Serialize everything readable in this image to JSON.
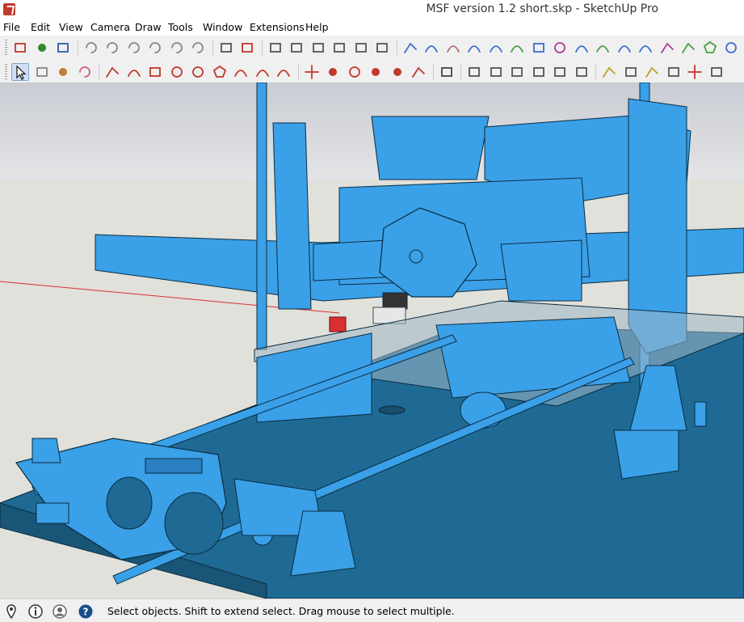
{
  "window": {
    "title": "MSF version 1.2 short.skp - SketchUp Pro"
  },
  "menu": [
    "File",
    "Edit",
    "View",
    "Camera",
    "Draw",
    "Tools",
    "Window",
    "Extensions",
    "Help"
  ],
  "toolbar1": [
    {
      "name": "new-model-icon",
      "color": "#c0392b"
    },
    {
      "name": "open-icon",
      "color": "#2e8b2e"
    },
    {
      "name": "save-icon",
      "color": "#2a5caa"
    },
    {
      "name": "cut-icon",
      "color": "#888888"
    },
    {
      "name": "copy-icon",
      "color": "#888888"
    },
    {
      "name": "paste-icon",
      "color": "#888888"
    },
    {
      "name": "erase-icon",
      "color": "#888888"
    },
    {
      "name": "undo-icon",
      "color": "#888888"
    },
    {
      "name": "redo-icon",
      "color": "#888888"
    },
    {
      "name": "print-icon",
      "color": "#555555"
    },
    {
      "name": "model-info-icon",
      "color": "#c0392b"
    },
    {
      "name": "iso-view-icon",
      "color": "#555555"
    },
    {
      "name": "top-view-icon",
      "color": "#555555"
    },
    {
      "name": "front-view-icon",
      "color": "#555555"
    },
    {
      "name": "right-view-icon",
      "color": "#555555"
    },
    {
      "name": "back-view-icon",
      "color": "#555555"
    },
    {
      "name": "left-view-icon",
      "color": "#555555"
    },
    {
      "name": "line-tool-icon",
      "color": "#3a6fd0"
    },
    {
      "name": "arc-tool-icon",
      "color": "#3a6fd0"
    },
    {
      "name": "freehand-icon",
      "color": "#b07070"
    },
    {
      "name": "curve-icon",
      "color": "#3a6fd0"
    },
    {
      "name": "offset-curve-icon",
      "color": "#3a6fd0"
    },
    {
      "name": "arc-green-icon",
      "color": "#49a040"
    },
    {
      "name": "rectangle-icon",
      "color": "#3a6fd0"
    },
    {
      "name": "circle-icon",
      "color": "#b03a9a"
    },
    {
      "name": "arc-blue-icon",
      "color": "#3a6fd0"
    },
    {
      "name": "bezier-icon",
      "color": "#49a040"
    },
    {
      "name": "fillet-icon",
      "color": "#3a6fd0"
    },
    {
      "name": "corner-icon",
      "color": "#3a6fd0"
    },
    {
      "name": "polyline-icon",
      "color": "#b03a9a"
    },
    {
      "name": "extend-icon",
      "color": "#49a040"
    },
    {
      "name": "polygon-icon",
      "color": "#49a040"
    },
    {
      "name": "spiral-icon",
      "color": "#3a6fd0"
    }
  ],
  "toolbar2": [
    {
      "name": "select-tool-icon",
      "color": "#222222",
      "selected": true
    },
    {
      "name": "component-icon",
      "color": "#888888"
    },
    {
      "name": "paint-bucket-icon",
      "color": "#c08030"
    },
    {
      "name": "eraser-icon",
      "color": "#d06080"
    },
    {
      "name": "pencil-icon",
      "color": "#c0392b"
    },
    {
      "name": "freehand-draw-icon",
      "color": "#c0392b"
    },
    {
      "name": "rectangle-draw-icon",
      "color": "#c0392b"
    },
    {
      "name": "rotated-rect-icon",
      "color": "#c0392b"
    },
    {
      "name": "circle-draw-icon",
      "color": "#c0392b"
    },
    {
      "name": "polygon-draw-icon",
      "color": "#c0392b"
    },
    {
      "name": "arc-draw-icon",
      "color": "#c0392b"
    },
    {
      "name": "arc-2pt-icon",
      "color": "#c0392b"
    },
    {
      "name": "pie-icon",
      "color": "#c0392b"
    },
    {
      "name": "move-icon",
      "color": "#c0392b"
    },
    {
      "name": "push-pull-icon",
      "color": "#c0392b"
    },
    {
      "name": "rotate-icon",
      "color": "#c0392b"
    },
    {
      "name": "follow-me-icon",
      "color": "#c0392b"
    },
    {
      "name": "scale-icon",
      "color": "#c0392b"
    },
    {
      "name": "offset-icon",
      "color": "#c0392b"
    },
    {
      "name": "outliner-icon",
      "color": "#444444"
    },
    {
      "name": "solid-tools-1-icon",
      "color": "#555555"
    },
    {
      "name": "solid-tools-2-icon",
      "color": "#555555"
    },
    {
      "name": "solid-tools-3-icon",
      "color": "#555555"
    },
    {
      "name": "solid-tools-4-icon",
      "color": "#555555"
    },
    {
      "name": "solid-tools-5-icon",
      "color": "#555555"
    },
    {
      "name": "solid-tools-6-icon",
      "color": "#555555"
    },
    {
      "name": "tape-measure-icon",
      "color": "#c0a020"
    },
    {
      "name": "dimension-icon",
      "color": "#555555"
    },
    {
      "name": "protractor-icon",
      "color": "#c0a020"
    },
    {
      "name": "text-tool-icon",
      "color": "#555555"
    },
    {
      "name": "axes-icon",
      "color": "#c0392b"
    },
    {
      "name": "3d-text-icon",
      "color": "#555555"
    }
  ],
  "status": {
    "text": "Select objects. Shift to extend select. Drag mouse to select multiple.",
    "icons": [
      "geo-location-icon",
      "credits-icon",
      "user-icon",
      "help-icon"
    ]
  },
  "colors": {
    "model": "#3aa0e8",
    "model_dark": "#2a7fc0",
    "base": "#1f6a94",
    "sky": "#d9dbe0",
    "ground": "#e2e2d8",
    "axis_red": "#d83030",
    "axis_green": "#3aa03a"
  }
}
